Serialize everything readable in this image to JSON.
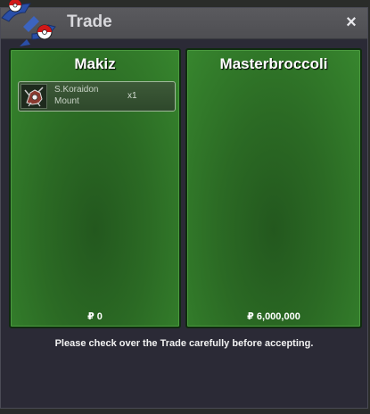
{
  "window": {
    "title": "Trade",
    "close_symbol": "×"
  },
  "left_panel": {
    "name": "Makiz",
    "items": [
      {
        "name": "S.Koraidon Mount",
        "quantity": "x1",
        "icon": "koraidon-icon"
      }
    ],
    "money_symbol": "₽",
    "money": "0"
  },
  "right_panel": {
    "name": "Masterbroccoli",
    "items": [],
    "money_symbol": "₽",
    "money": "6,000,000"
  },
  "notice": "Please check over the Trade carefully before accepting.",
  "colors": {
    "panel_green": "#2b6a24",
    "window_bg": "#2b2a36",
    "titlebar": "#5a5a5e"
  }
}
